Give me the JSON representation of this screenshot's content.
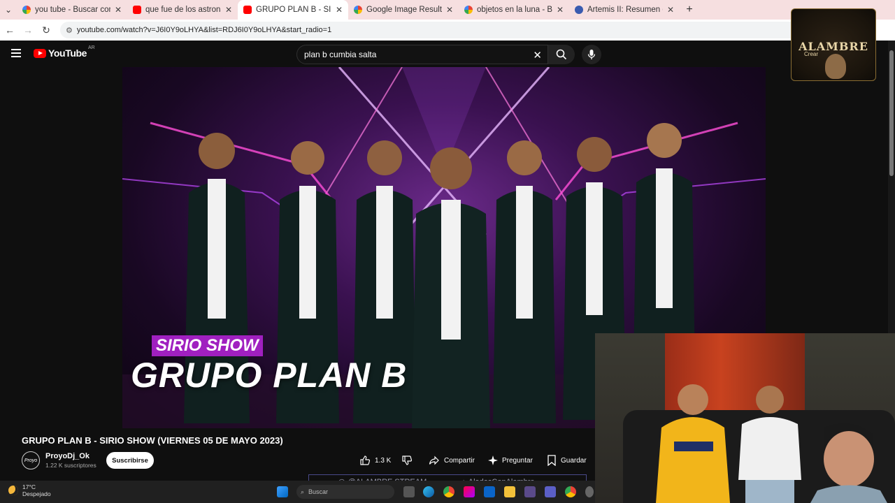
{
  "browser": {
    "tabs": [
      {
        "favicon": "google-icon",
        "title": "you tube - Buscar con Google"
      },
      {
        "favicon": "youtube-icon",
        "title": "que fue de los astronautas que"
      },
      {
        "favicon": "youtube-icon",
        "title": "GRUPO PLAN B - SIRIO SHOW",
        "active": true
      },
      {
        "favicon": "google-icon",
        "title": "Google Image Result"
      },
      {
        "favicon": "google-icon",
        "title": "objetos en la luna - Buscar con"
      },
      {
        "favicon": "wiki-icon",
        "title": "Artemis II: Resumen de la misió"
      }
    ],
    "url": "youtube.com/watch?v=J6I0Y9oLHYA&list=RDJ6I0Y9oLHYA&start_radio=1"
  },
  "youtube": {
    "logo_text": "YouTube",
    "country": "AR",
    "search_value": "plan b cumbia salta"
  },
  "video": {
    "overlay_tag": "SIRIO SHOW",
    "overlay_title": "GRUPO PLAN B",
    "title": "GRUPO PLAN B - SIRIO SHOW (VIERNES 05 DE MAYO 2023)",
    "channel_name": "ProyoDj_Ok",
    "avatar_text": "Proyo",
    "subscribers": "1.22 K suscriptores",
    "subscribe_label": "Suscribirse",
    "likes": "1.3 K",
    "share_label": "Compartir",
    "ask_label": "Preguntar",
    "save_label": "Guardar"
  },
  "stream_overlay": {
    "logo_text": "ALAMBRE",
    "logo_sub": "Crear",
    "handle_left": "@ALAMBRE.STREAM",
    "handle_right": "AladosConAlambre"
  },
  "taskbar": {
    "temperature": "17°C",
    "condition": "Despejado",
    "search_placeholder": "Buscar"
  },
  "colors": {
    "accent_red": "#ff0000",
    "tab_strip": "#f6dfe0",
    "yt_background": "#0f0f0f",
    "tag_purple": "#a020c0"
  }
}
